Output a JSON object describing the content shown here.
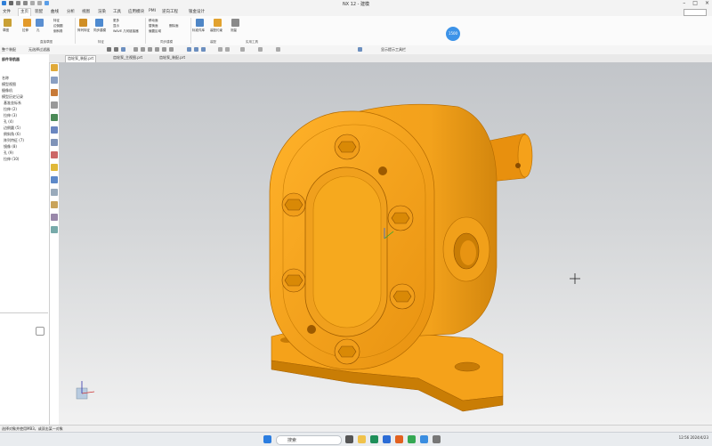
{
  "window": {
    "title": "NX 12 - 建模"
  },
  "menu": {
    "tabs": [
      "文件",
      "主页",
      "装配",
      "曲线",
      "分析",
      "视图",
      "渲染",
      "工具",
      "应用模块",
      "PMI",
      "逆向工程",
      "钣金设计"
    ],
    "active_index": 1
  },
  "ribbon": {
    "buttons": [
      "草图",
      "拉伸",
      "孔",
      "特征",
      "边倒圆",
      "倒斜角",
      "阵列特征",
      "同步建模",
      "更多",
      "显示",
      "WAVE 几何链接器",
      "移动面",
      "替换面",
      "偏置区域",
      "删除面",
      "标准件库",
      "装配约束",
      "测量"
    ],
    "groups": [
      "直接草图",
      "特征",
      "同步建模",
      "装配",
      "实用工具"
    ],
    "badge": "1500"
  },
  "toolbar2": {
    "filter_value": "整个装配",
    "snap_label": "无选择过滤器",
    "extra_label": "显示提示工具栏"
  },
  "doc_tabs": [
    "齿轮泵_装配.prt",
    "齿轮泵_主视图.prt",
    "齿轮泵_装配.prt"
  ],
  "left_panel": {
    "header": "部件导航器",
    "rows": [
      "名称",
      "模型视图",
      "摄像机",
      "模型历史记录",
      "基准坐标系",
      "拉伸 (2)",
      "拉伸 (3)",
      "孔 (4)",
      "边倒圆 (5)",
      "倒斜角 (6)",
      "阵列特征 (7)",
      "镜像 (8)",
      "孔 (9)",
      "拉伸 (10)"
    ]
  },
  "status": {
    "text": "选择对象并使用MB3，或双击某一对象"
  },
  "taskbar": {
    "search_placeholder": "搜索",
    "time": "12:56",
    "date": "2024/4/23"
  },
  "colors": {
    "model": "#f39a10",
    "model_shadow": "#b86b00",
    "accent": "#3d93e8"
  }
}
